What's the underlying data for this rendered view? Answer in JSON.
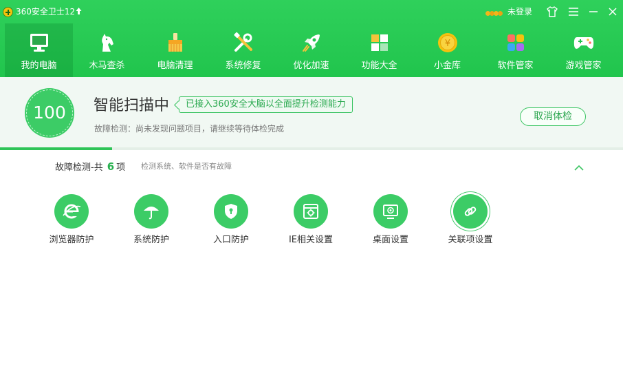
{
  "titlebar": {
    "app_title": "360安全卫士12",
    "update_icon": "up-arrow-icon",
    "login_text": "未登录"
  },
  "nav": {
    "items": [
      {
        "label": "我的电脑",
        "icon": "computer-icon",
        "active": true
      },
      {
        "label": "木马查杀",
        "icon": "horse-icon",
        "active": false
      },
      {
        "label": "电脑清理",
        "icon": "broom-icon",
        "active": false
      },
      {
        "label": "系统修复",
        "icon": "repair-tools-icon",
        "active": false
      },
      {
        "label": "优化加速",
        "icon": "rocket-icon",
        "active": false
      },
      {
        "label": "功能大全",
        "icon": "grid-apps-icon",
        "active": false
      },
      {
        "label": "小金库",
        "icon": "gold-coin-icon",
        "active": false
      },
      {
        "label": "软件管家",
        "icon": "software-icon",
        "active": false
      },
      {
        "label": "游戏管家",
        "icon": "gamepad-icon",
        "active": false
      }
    ]
  },
  "scan": {
    "score": "100",
    "title": "智能扫描中",
    "ai_badge": "已接入360安全大脑以全面提升检测能力",
    "status": "故障检测：尚未发现问题项目，请继续等待体检完成",
    "cancel_label": "取消体检",
    "progress_percent": 18
  },
  "section": {
    "title_prefix": "故障检测-共",
    "count": "6",
    "title_suffix": "项",
    "subtitle": "检测系统、软件是否有故障"
  },
  "items": [
    {
      "label": "浏览器防护",
      "icon": "ie-browser-icon"
    },
    {
      "label": "系统防护",
      "icon": "umbrella-icon"
    },
    {
      "label": "入口防护",
      "icon": "shield-lock-icon"
    },
    {
      "label": "IE相关设置",
      "icon": "ie-settings-icon"
    },
    {
      "label": "桌面设置",
      "icon": "desktop-icon"
    },
    {
      "label": "关联项设置",
      "icon": "link-icon"
    }
  ],
  "colors": {
    "brand_green": "#21c54d",
    "accent_green": "#3ccc66",
    "text_dark": "#333333"
  }
}
